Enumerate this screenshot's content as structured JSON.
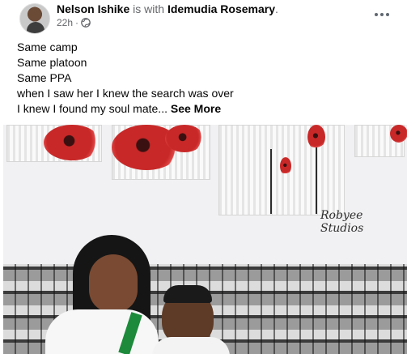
{
  "post": {
    "author": "Nelson Ishike",
    "with_text": "is with",
    "tagged": "Idemudia Rosemary",
    "tagged_suffix": ".",
    "time": "22h",
    "time_sep": "·",
    "privacy_icon": "globe-icon",
    "menu_icon": "more-options-icon",
    "lines": [
      "Same camp",
      "Same platoon",
      "Same PPA",
      "when I saw her I knew the search was over",
      "I knew I found my soul mate..."
    ],
    "see_more": "See More",
    "photo_watermark": "Robyee Studios"
  },
  "colors": {
    "text": "#050505",
    "muted": "#65676b",
    "poppy_red": "#c82828"
  }
}
